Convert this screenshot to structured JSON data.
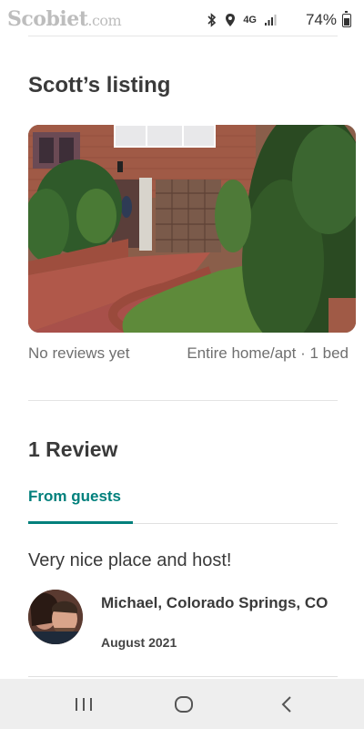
{
  "status_bar": {
    "brand": "Scobiet",
    "brand_suffix": ".com",
    "network": "4G",
    "battery": "74%"
  },
  "listing": {
    "title": "Scott’s listing",
    "photo_alt": "Brick house with garage and hedges",
    "reviews_status": "No reviews yet",
    "room_info": "Entire home/apt · 1 bed"
  },
  "reviews": {
    "heading": "1 Review",
    "tab_label": "From guests",
    "items": [
      {
        "text": "Very nice place and host!",
        "reviewer": "Michael, Colorado Springs, CO",
        "date": "August 2021"
      }
    ]
  },
  "nav": {
    "recent_icon": "recent-apps-icon",
    "home_icon": "home-circle-icon",
    "back_icon": "back-chevron-icon"
  }
}
